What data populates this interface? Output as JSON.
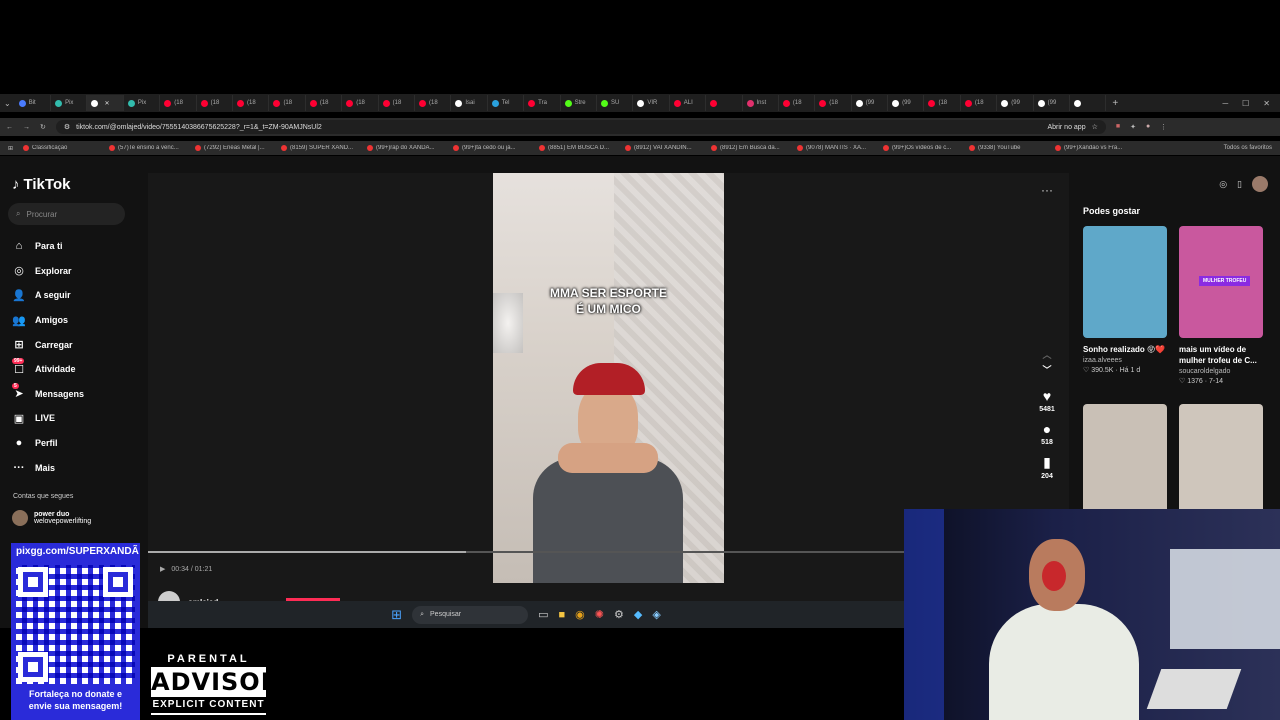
{
  "browser": {
    "tabs": [
      {
        "label": "Bit",
        "color": "#4a7cff"
      },
      {
        "label": "Pix",
        "color": "#32bcad"
      },
      {
        "label": "",
        "color": "#ffffff",
        "active": true
      },
      {
        "label": "Pix",
        "color": "#32bcad"
      },
      {
        "label": "(18",
        "color": "#ff0033"
      },
      {
        "label": "(18",
        "color": "#ff0033"
      },
      {
        "label": "(18",
        "color": "#ff0033"
      },
      {
        "label": "(18",
        "color": "#ff0033"
      },
      {
        "label": "(18",
        "color": "#ff0033"
      },
      {
        "label": "(18",
        "color": "#ff0033"
      },
      {
        "label": "(18",
        "color": "#ff0033"
      },
      {
        "label": "(18",
        "color": "#ff0033"
      },
      {
        "label": "Isai",
        "color": "#ffffff"
      },
      {
        "label": "Tel",
        "color": "#2aa1de"
      },
      {
        "label": "Tra",
        "color": "#ff0033"
      },
      {
        "label": "Stre",
        "color": "#53fc18"
      },
      {
        "label": "SU",
        "color": "#53fc18"
      },
      {
        "label": "VIR",
        "color": "#ffffff"
      },
      {
        "label": "ALI",
        "color": "#ff0033"
      },
      {
        "label": "",
        "color": "#ff0033"
      },
      {
        "label": "Inst",
        "color": "#e1306c"
      },
      {
        "label": "(18",
        "color": "#ff0033"
      },
      {
        "label": "(18",
        "color": "#ff0033"
      },
      {
        "label": "(99",
        "color": "#ffffff"
      },
      {
        "label": "(99",
        "color": "#ffffff"
      },
      {
        "label": "(18",
        "color": "#ff0033"
      },
      {
        "label": "(18",
        "color": "#ff0033"
      },
      {
        "label": "(99",
        "color": "#ffffff"
      },
      {
        "label": "(99",
        "color": "#ffffff"
      },
      {
        "label": "",
        "color": "#ffffff"
      }
    ],
    "url": "tiktok.com/@omlajed/video/7555140386675625228?_r=1&_t=ZM-90AMJNsUl2",
    "open_in_app": "Abrir no app",
    "bookmarks": [
      "Classificação",
      "(57)Te ensino a venc...",
      "(7292) Enéas Metal |...",
      "(8159) SUPER XAND...",
      "(99+)rap do XANDÃ...",
      "(99+)tá cedo ou já...",
      "(8851) EM BUSCA D...",
      "(8912) VAI XANDIN...",
      "(8912) Em Busca da...",
      "(9078) MANTIS · XA...",
      "(99+)Os vídeos de c...",
      "(9338) YouTube",
      "(99+)Xandão vs Fra..."
    ],
    "all_favorites": "Todos os favoritos"
  },
  "tiktok": {
    "logo": "TikTok",
    "search_placeholder": "Procurar",
    "nav": [
      {
        "label": "Para ti",
        "icon": "home-icon",
        "glyph": "⌂"
      },
      {
        "label": "Explorar",
        "icon": "compass-icon",
        "glyph": "◎"
      },
      {
        "label": "A seguir",
        "icon": "following-icon",
        "glyph": "👤"
      },
      {
        "label": "Amigos",
        "icon": "friends-icon",
        "glyph": "👥"
      },
      {
        "label": "Carregar",
        "icon": "upload-icon",
        "glyph": "⊞"
      },
      {
        "label": "Atividade",
        "icon": "activity-icon",
        "glyph": "☐",
        "badge": "99+"
      },
      {
        "label": "Mensagens",
        "icon": "messages-icon",
        "glyph": "➤",
        "badge": "5"
      },
      {
        "label": "LIVE",
        "icon": "live-icon",
        "glyph": "▣"
      },
      {
        "label": "Perfil",
        "icon": "profile-icon",
        "glyph": "●"
      },
      {
        "label": "Mais",
        "icon": "more-icon",
        "glyph": "···"
      }
    ],
    "follows_title": "Contas que segues",
    "followed": {
      "name": "power duo",
      "handle": "welovepowerlifting"
    },
    "video": {
      "caption_line1": "MMA SER ESPORTE",
      "caption_line2": "É UM MICO",
      "time": "00:34 / 01:21",
      "progress": 0.42,
      "author": "omlajed",
      "likes": "5481",
      "comments": "518",
      "saves": "204"
    },
    "suggestions_title": "Podes gostar",
    "suggestions": [
      {
        "title": "Sonho realizado 😝❤️",
        "user": "izaa.alveees",
        "stats": "♡ 390.5K · Há 1 d",
        "bg": "#5fa8c9"
      },
      {
        "title": "mais um vídeo de mulher trofeu de C...",
        "user": "soucaroldelgado",
        "stats": "♡ 1376 · 7-14",
        "bg": "#c9589e",
        "tag": "MULHER TROFEU"
      },
      {
        "title": "",
        "user": "",
        "stats": "",
        "bg": "#c9c0b6"
      },
      {
        "title": "",
        "user": "",
        "stats": "",
        "bg": "#cfc6bc"
      }
    ]
  },
  "taskbar": {
    "search_placeholder": "Pesquisar"
  },
  "overlay": {
    "qr_title": "pixgg.com/SUPERXANDÃ",
    "qr_footer_1": "Fortaleça no donate e",
    "qr_footer_2": "envie sua mensagem!",
    "advisory_1": "PARENTAL",
    "advisory_2": "ADVISORY",
    "advisory_3": "EXPLICIT CONTENT"
  }
}
